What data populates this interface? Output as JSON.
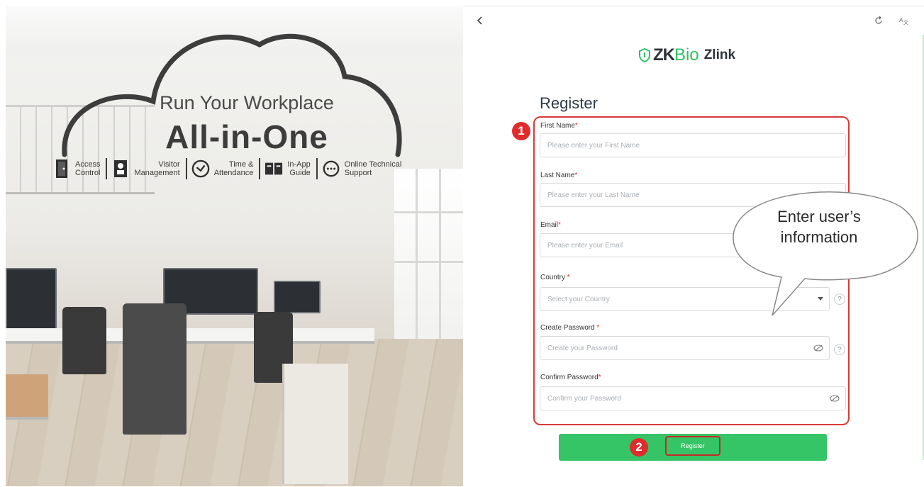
{
  "hero": {
    "line1": "Run Your Workplace",
    "line2": "All-in-One",
    "features": [
      {
        "icon": "door-icon",
        "label": "Access\nControl"
      },
      {
        "icon": "visitor-badge-icon",
        "label": "Visitor\nManagement"
      },
      {
        "icon": "clock-icon",
        "label": "Time &\nAttendance"
      },
      {
        "icon": "book-icon",
        "label": "In-App\nGuide"
      },
      {
        "icon": "support-chat-icon",
        "label": "Online Technical\nSupport"
      }
    ]
  },
  "panel": {
    "back_icon": "chevron-left-icon",
    "top_icons": [
      "refresh-icon",
      "language-icon"
    ],
    "logo": {
      "zk": "ZK",
      "bio": "Bio",
      "zlink": "Zlink",
      "icon": "shield-icon"
    },
    "title": "Register",
    "fields": [
      {
        "label": "First Name",
        "required_mark": "*",
        "placeholder": "Please enter your First Name"
      },
      {
        "label": "Last Name",
        "required_mark": "*",
        "placeholder": "Please enter your Last Name"
      },
      {
        "label": "Email",
        "required_mark": "*",
        "placeholder": "Please enter your Email"
      },
      {
        "label": "Country ",
        "required_mark": "*",
        "placeholder": "Select your Country"
      },
      {
        "label": "Create Password ",
        "required_mark": "*",
        "placeholder": "Create your Password"
      },
      {
        "label": "Confirm Password",
        "required_mark": "*",
        "placeholder": "Confirm your Password"
      }
    ],
    "help_mark": "?",
    "register_button": "Register"
  },
  "annotations": {
    "step1": "1",
    "step2": "2",
    "bubble_line1": "Enter user’s",
    "bubble_line2": "information",
    "highlight_color": "#d93a3a"
  },
  "colors": {
    "accent_green": "#35c466",
    "brand_green": "#2ebf62",
    "annotation_red": "#e02c2c"
  }
}
